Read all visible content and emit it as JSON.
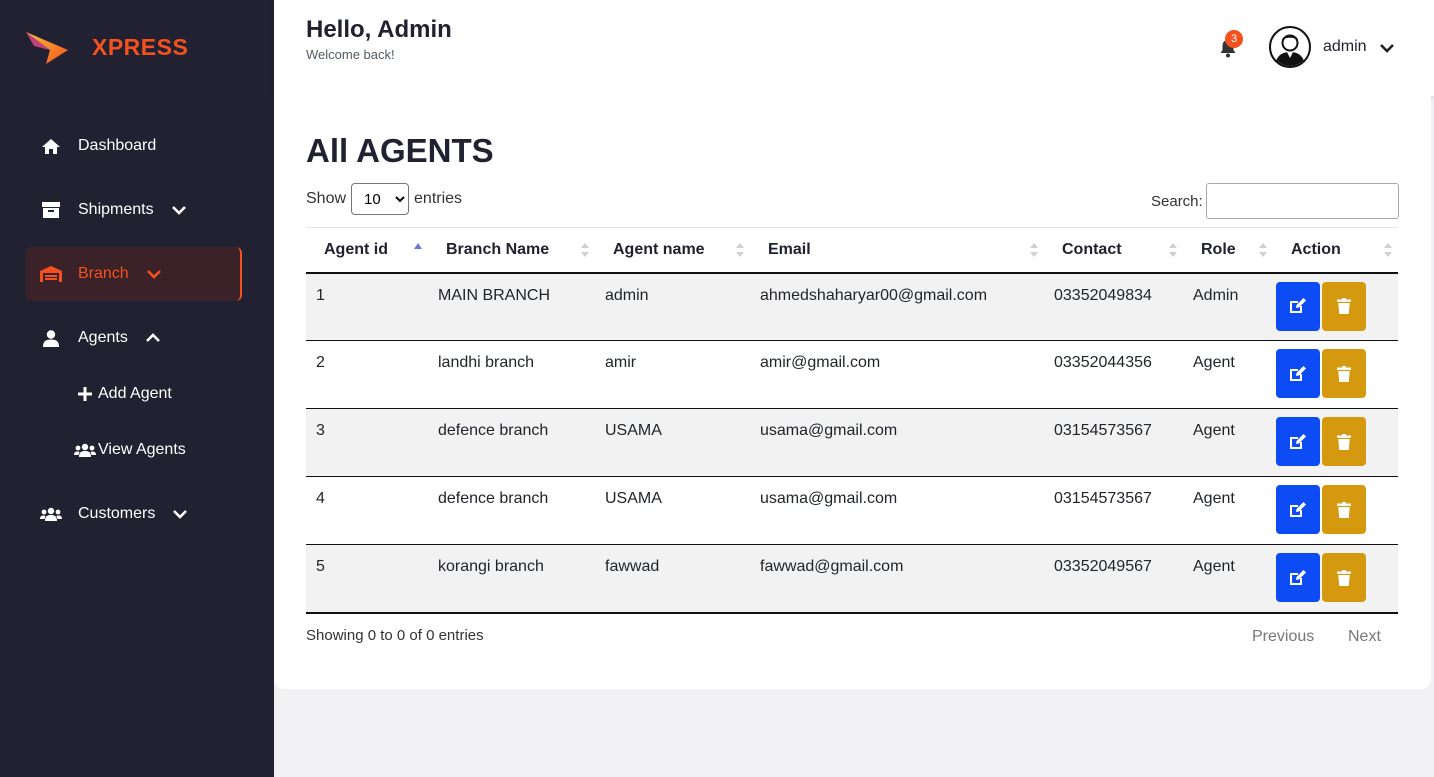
{
  "brand": {
    "name": "XPRESS",
    "accent_color": "#f4511e",
    "sidebar_bg": "#212131"
  },
  "sidebar": {
    "items": [
      {
        "label": "Dashboard",
        "icon": "home-icon",
        "chevron": "none"
      },
      {
        "label": "Shipments",
        "icon": "box-icon",
        "chevron": "chevron-down-icon"
      },
      {
        "label": "Branch",
        "icon": "warehouse-icon",
        "chevron": "chevron-down-icon",
        "active": true
      },
      {
        "label": "Agents",
        "icon": "user-icon",
        "chevron": "chevron-up-icon"
      },
      {
        "label": "Customers",
        "icon": "users-icon",
        "chevron": "chevron-down-icon"
      }
    ],
    "subitems": [
      {
        "label": "Add Agent",
        "icon": "plus-icon"
      },
      {
        "label": "View Agents",
        "icon": "users-icon"
      }
    ]
  },
  "header": {
    "greeting": "Hello, Admin",
    "subtitle": "Welcome back!",
    "notification_count": "3",
    "username": "admin"
  },
  "main": {
    "title": "All AGENTS",
    "show_label": "Show",
    "entries_label": "entries",
    "page_size_selected": "10",
    "search_label": "Search:",
    "search_value": "",
    "columns": [
      "Agent id",
      "Branch Name",
      "Agent name",
      "Email",
      "Contact",
      "Role",
      "Action"
    ],
    "rows": [
      [
        "1",
        "MAIN BRANCH",
        "admin",
        "ahmedshaharyar00@gmail.com",
        "03352049834",
        "Admin"
      ],
      [
        "2",
        "landhi branch",
        "amir",
        "amir@gmail.com",
        "03352044356",
        "Agent"
      ],
      [
        "3",
        "defence branch",
        "USAMA",
        "usama@gmail.com",
        "03154573567",
        "Agent"
      ],
      [
        "4",
        "defence branch",
        "USAMA",
        "usama@gmail.com",
        "03154573567",
        "Agent"
      ],
      [
        "5",
        "korangi branch",
        "fawwad",
        "fawwad@gmail.com",
        "03352049567",
        "Agent"
      ]
    ],
    "info": "Showing 0 to 0 of 0 entries",
    "previous_label": "Previous",
    "next_label": "Next",
    "edit_color": "#0d4cf5",
    "delete_color": "#d4990f"
  }
}
